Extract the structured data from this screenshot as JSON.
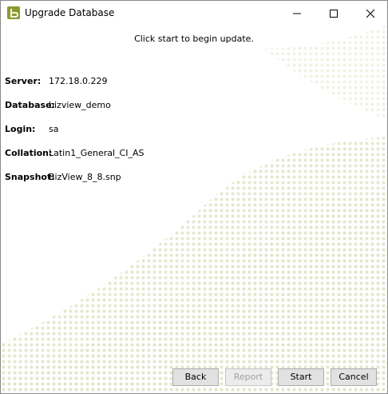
{
  "window": {
    "title": "Upgrade Database"
  },
  "instruction": "Click start to begin update.",
  "fields": [
    {
      "label": "Server:",
      "value": "172.18.0.229"
    },
    {
      "label": "Database:",
      "value": "bizview_demo"
    },
    {
      "label": "Login:",
      "value": "sa"
    },
    {
      "label": "Collation:",
      "value": "Latin1_General_CI_AS"
    },
    {
      "label": "Snapshot:",
      "value": "BizView_8_8.snp"
    }
  ],
  "buttons": {
    "back": "Back",
    "report": "Report",
    "start": "Start",
    "cancel": "Cancel"
  },
  "colors": {
    "accent": "#8c9a2e",
    "wave": "#dfe6c9"
  }
}
